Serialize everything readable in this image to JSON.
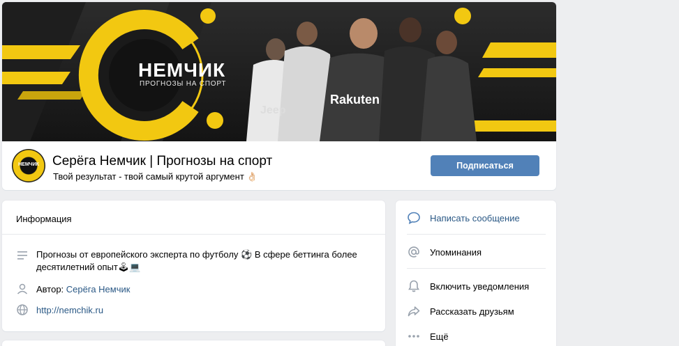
{
  "cover": {
    "brand": "НЕМЧИК",
    "tagline": "ПРОГНОЗЫ НА СПОРТ",
    "jersey_text": "Rakuten",
    "jersey_text_2": "Jeep"
  },
  "group": {
    "avatar_text": "НЕМЧИК",
    "name": "Серёга Немчик | Прогнозы на спорт",
    "status": "Твой результат - твой самый крутой аргумент 👌🏻",
    "subscribe_label": "Подписаться"
  },
  "info": {
    "title": "Информация",
    "description_line1": "Прогнозы от европейского эксперта по футболу ⚽ В сфере беттинга более",
    "description_line2": "десятилетний опыт🕹💻",
    "author_label": "Автор: ",
    "author_name": "Серёга Немчик",
    "website": "http://nemchik.ru"
  },
  "actions": {
    "message": "Написать сообщение",
    "mentions": "Упоминания",
    "notifications": "Включить уведомления",
    "share": "Рассказать друзьям",
    "more": "Ещё"
  },
  "colors": {
    "accent": "#5181b8",
    "link": "#2a5885",
    "brand_yellow": "#f2c811",
    "background": "#edeef0"
  }
}
